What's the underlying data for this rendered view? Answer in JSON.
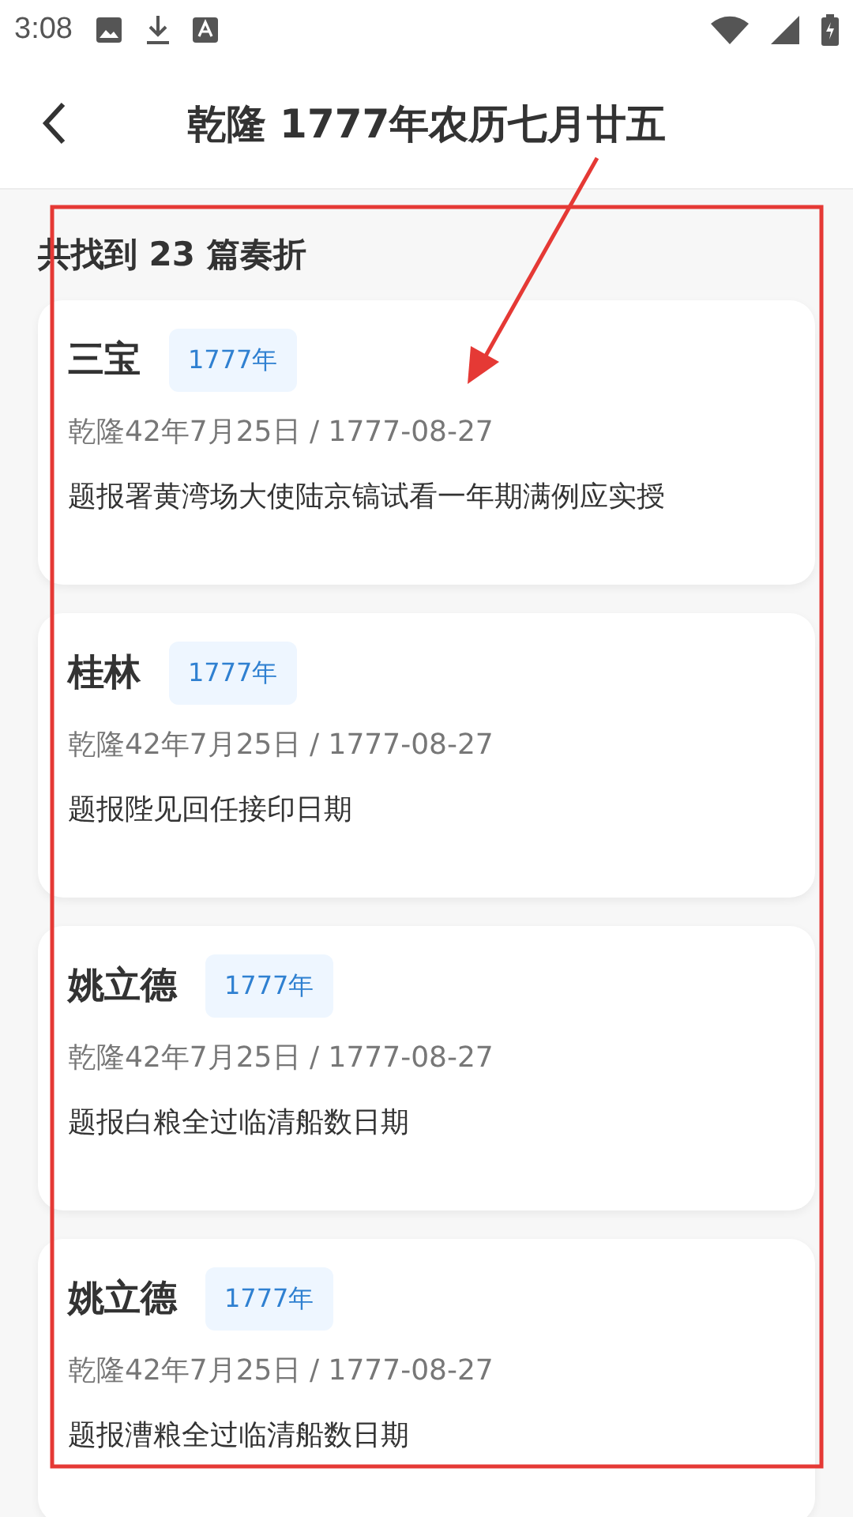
{
  "status_bar": {
    "time": "3:08"
  },
  "header": {
    "title": "乾隆 1777年农历七月廿五"
  },
  "result_count": "共找到 23 篇奏折",
  "memorials": [
    {
      "author": "三宝",
      "year_tag": "1777年",
      "date": "乾隆42年7月25日 / 1777-08-27",
      "title": "题报署黄湾场大使陆京镐试看一年期满例应实授"
    },
    {
      "author": "桂林",
      "year_tag": "1777年",
      "date": "乾隆42年7月25日 / 1777-08-27",
      "title": "题报陛见回任接印日期"
    },
    {
      "author": "姚立德",
      "year_tag": "1777年",
      "date": "乾隆42年7月25日 / 1777-08-27",
      "title": "题报白粮全过临清船数日期"
    },
    {
      "author": "姚立德",
      "year_tag": "1777年",
      "date": "乾隆42年7月25日 / 1777-08-27",
      "title": "题报漕粮全过临清船数日期"
    }
  ]
}
